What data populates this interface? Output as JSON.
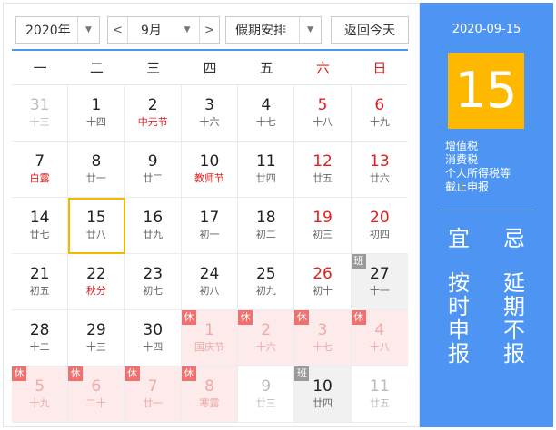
{
  "toolbar": {
    "year_value": "2020年",
    "month_value": "9月",
    "holiday_value": "假期安排",
    "today_label": "返回今天",
    "prev_arrow": "<",
    "next_arrow": ">",
    "caret": "▼"
  },
  "weekdays": [
    "一",
    "二",
    "三",
    "四",
    "五",
    "六",
    "日"
  ],
  "weeks": [
    [
      {
        "day": "31",
        "lunar": "十三",
        "other": true
      },
      {
        "day": "1",
        "lunar": "十四"
      },
      {
        "day": "2",
        "lunar": "中元节",
        "fest": true
      },
      {
        "day": "3",
        "lunar": "十六"
      },
      {
        "day": "4",
        "lunar": "十七"
      },
      {
        "day": "5",
        "lunar": "十八",
        "weekend": true
      },
      {
        "day": "6",
        "lunar": "十九",
        "weekend": true
      }
    ],
    [
      {
        "day": "7",
        "lunar": "白露",
        "fest": true
      },
      {
        "day": "8",
        "lunar": "廿一"
      },
      {
        "day": "9",
        "lunar": "廿二"
      },
      {
        "day": "10",
        "lunar": "教师节",
        "fest": true
      },
      {
        "day": "11",
        "lunar": "廿四"
      },
      {
        "day": "12",
        "lunar": "廿五",
        "weekend": true
      },
      {
        "day": "13",
        "lunar": "廿六",
        "weekend": true
      }
    ],
    [
      {
        "day": "14",
        "lunar": "廿七"
      },
      {
        "day": "15",
        "lunar": "廿八",
        "selected": true
      },
      {
        "day": "16",
        "lunar": "廿九"
      },
      {
        "day": "17",
        "lunar": "初一"
      },
      {
        "day": "18",
        "lunar": "初二"
      },
      {
        "day": "19",
        "lunar": "初三",
        "weekend": true
      },
      {
        "day": "20",
        "lunar": "初四",
        "weekend": true
      }
    ],
    [
      {
        "day": "21",
        "lunar": "初五"
      },
      {
        "day": "22",
        "lunar": "秋分",
        "fest": true
      },
      {
        "day": "23",
        "lunar": "初七"
      },
      {
        "day": "24",
        "lunar": "初八"
      },
      {
        "day": "25",
        "lunar": "初九"
      },
      {
        "day": "26",
        "lunar": "初十",
        "weekend": true
      },
      {
        "day": "27",
        "lunar": "十一",
        "badge": "班"
      }
    ],
    [
      {
        "day": "28",
        "lunar": "十二"
      },
      {
        "day": "29",
        "lunar": "十三"
      },
      {
        "day": "30",
        "lunar": "十四"
      },
      {
        "day": "1",
        "lunar": "国庆节",
        "other": true,
        "badge": "休"
      },
      {
        "day": "2",
        "lunar": "十六",
        "other": true,
        "badge": "休"
      },
      {
        "day": "3",
        "lunar": "十七",
        "other": true,
        "badge": "休"
      },
      {
        "day": "4",
        "lunar": "十八",
        "other": true,
        "badge": "休"
      }
    ],
    [
      {
        "day": "5",
        "lunar": "十九",
        "other": true,
        "badge": "休"
      },
      {
        "day": "6",
        "lunar": "二十",
        "other": true,
        "badge": "休"
      },
      {
        "day": "7",
        "lunar": "廿一",
        "other": true,
        "badge": "休"
      },
      {
        "day": "8",
        "lunar": "寒露",
        "other": true,
        "badge": "休"
      },
      {
        "day": "9",
        "lunar": "廿三",
        "other": true
      },
      {
        "day": "10",
        "lunar": "廿四",
        "badge": "班"
      },
      {
        "day": "11",
        "lunar": "廿五",
        "other": true
      }
    ]
  ],
  "side": {
    "date": "2020-09-15",
    "big_day": "15",
    "tax_notes": [
      "增值税",
      "消费税",
      "个人所得税等",
      "截止申报"
    ],
    "yi_label": "宜",
    "ji_label": "忌",
    "yi_items": [
      "按",
      "时",
      "申",
      "报"
    ],
    "ji_items": [
      "延",
      "期",
      "不",
      "报"
    ]
  },
  "colors": {
    "accent_blue": "#4e95f3",
    "highlight_yellow": "#ffb800",
    "holiday_red": "#e02020",
    "rest_bg": "#fdeaea",
    "work_bg": "#f1f1f1"
  }
}
